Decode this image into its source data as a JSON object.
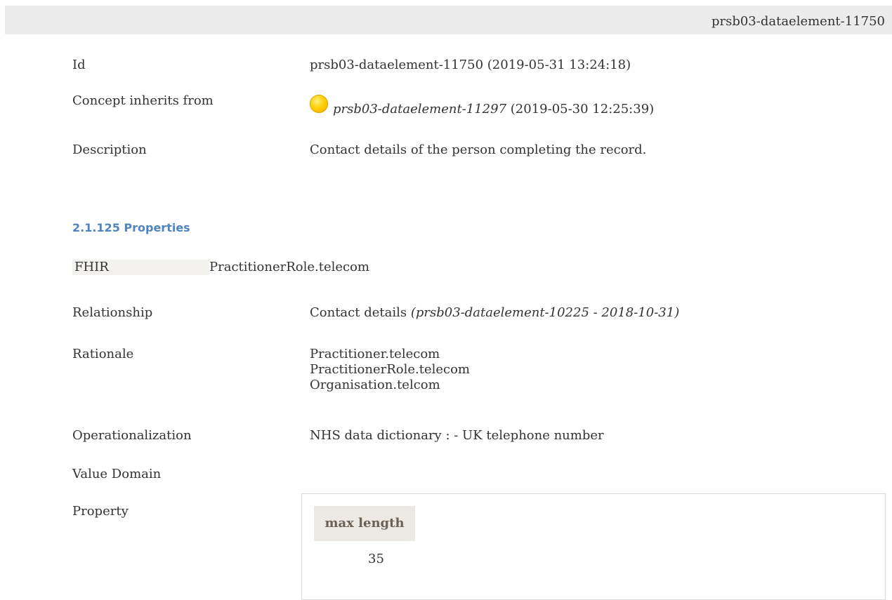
{
  "header": {
    "id_title": "prsb03-dataelement-11750"
  },
  "details": {
    "id": {
      "label": "Id",
      "value": "prsb03-dataelement-11750 (2019-05-31 13:24:18)"
    },
    "inherits": {
      "label": "Concept inherits from",
      "status_icon": "yellow-status-dot-icon",
      "id": "prsb03-dataelement-11297",
      "date": "(2019-05-30 12:25:39)"
    },
    "description": {
      "label": "Description",
      "value": "Contact details of the person completing the record."
    }
  },
  "properties": {
    "title": "2.1.125 Properties",
    "fhir": {
      "key": "FHIR",
      "value": "PractitionerRole.telecom"
    },
    "relationship": {
      "label": "Relationship",
      "value": "Contact details",
      "ref": "(prsb03-dataelement-10225 - 2018-10-31)"
    },
    "rationale": {
      "label": "Rationale",
      "lines": [
        "Practitioner.telecom",
        "PractitionerRole.telecom",
        "Organisation.telcom"
      ]
    },
    "operationalization": {
      "label": "Operationalization",
      "value": "NHS data dictionary : - UK telephone number"
    },
    "value_domain": {
      "label": "Value Domain"
    },
    "property": {
      "label": "Property",
      "header": "max length",
      "value": "35"
    }
  },
  "colors": {
    "section_title": "#4f84bf",
    "header_bg": "#ececec",
    "status_dot": "#ffd000"
  }
}
